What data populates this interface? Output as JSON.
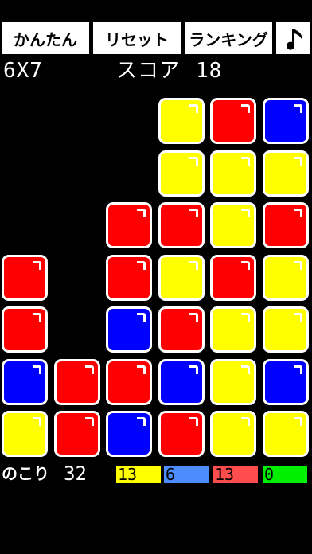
{
  "toolbar": {
    "easy_label": "かんたん",
    "reset_label": "リセット",
    "ranking_label": "ランキング",
    "sound_icon": "music-note-icon"
  },
  "info": {
    "board_size": "6X7",
    "score_label": "スコア",
    "score_value": "18"
  },
  "board": {
    "columns": 6,
    "rows": 7,
    "colors": {
      "Y": "#ffff00",
      "R": "#ff0000",
      "B": "#0000ff"
    },
    "cells": [
      [
        null,
        null,
        null,
        "Y",
        "R",
        "B"
      ],
      [
        null,
        null,
        null,
        "Y",
        "Y",
        "Y"
      ],
      [
        null,
        null,
        "R",
        "R",
        "Y",
        "R"
      ],
      [
        "R",
        null,
        "R",
        "Y",
        "R",
        "Y"
      ],
      [
        "R",
        null,
        "B",
        "R",
        "Y",
        "Y"
      ],
      [
        "B",
        "R",
        "R",
        "B",
        "Y",
        "B"
      ],
      [
        "Y",
        "R",
        "B",
        "R",
        "Y",
        "Y"
      ]
    ]
  },
  "footer": {
    "remaining_label": "のこり",
    "remaining_value": "32",
    "counts": {
      "yellow": "13",
      "blue": "6",
      "red": "13",
      "green": "0"
    },
    "count_colors": {
      "yellow": "#ffff00",
      "blue": "#4d8cff",
      "red": "#ff4d4d",
      "green": "#00ee00"
    }
  }
}
